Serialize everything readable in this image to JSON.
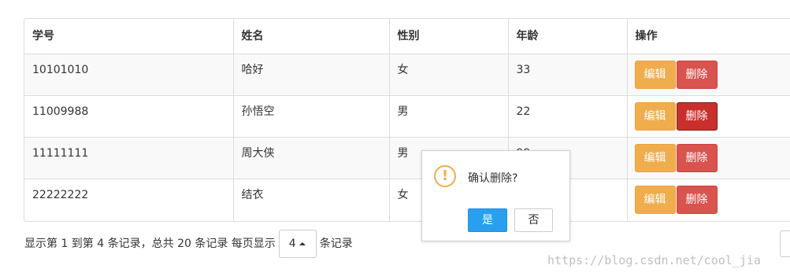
{
  "table": {
    "headers": [
      "学号",
      "姓名",
      "性别",
      "年龄",
      "操作"
    ],
    "rows": [
      {
        "id": "10101010",
        "name": "哈好",
        "gender": "女",
        "age": "33"
      },
      {
        "id": "11009988",
        "name": "孙悟空",
        "gender": "男",
        "age": "22"
      },
      {
        "id": "11111111",
        "name": "周大侠",
        "gender": "男",
        "age": "99"
      },
      {
        "id": "22222222",
        "name": "结衣",
        "gender": "女",
        "age": ""
      }
    ],
    "edit_label": "编辑",
    "delete_label": "删除"
  },
  "footer": {
    "prefix": "显示第 1 到第 4 条记录，总共 20 条记录 每页显示",
    "page_size": "4",
    "suffix": "条记录"
  },
  "confirm_popup": {
    "icon": "!",
    "message": "确认删除?",
    "yes_label": "是",
    "no_label": "否"
  },
  "watermark": "https://blog.csdn.net/cool_jia",
  "colors": {
    "edit": "#f0ad4e",
    "delete": "#d9534f",
    "delete_active": "#c9302c",
    "confirm": "#2a9ff0"
  }
}
